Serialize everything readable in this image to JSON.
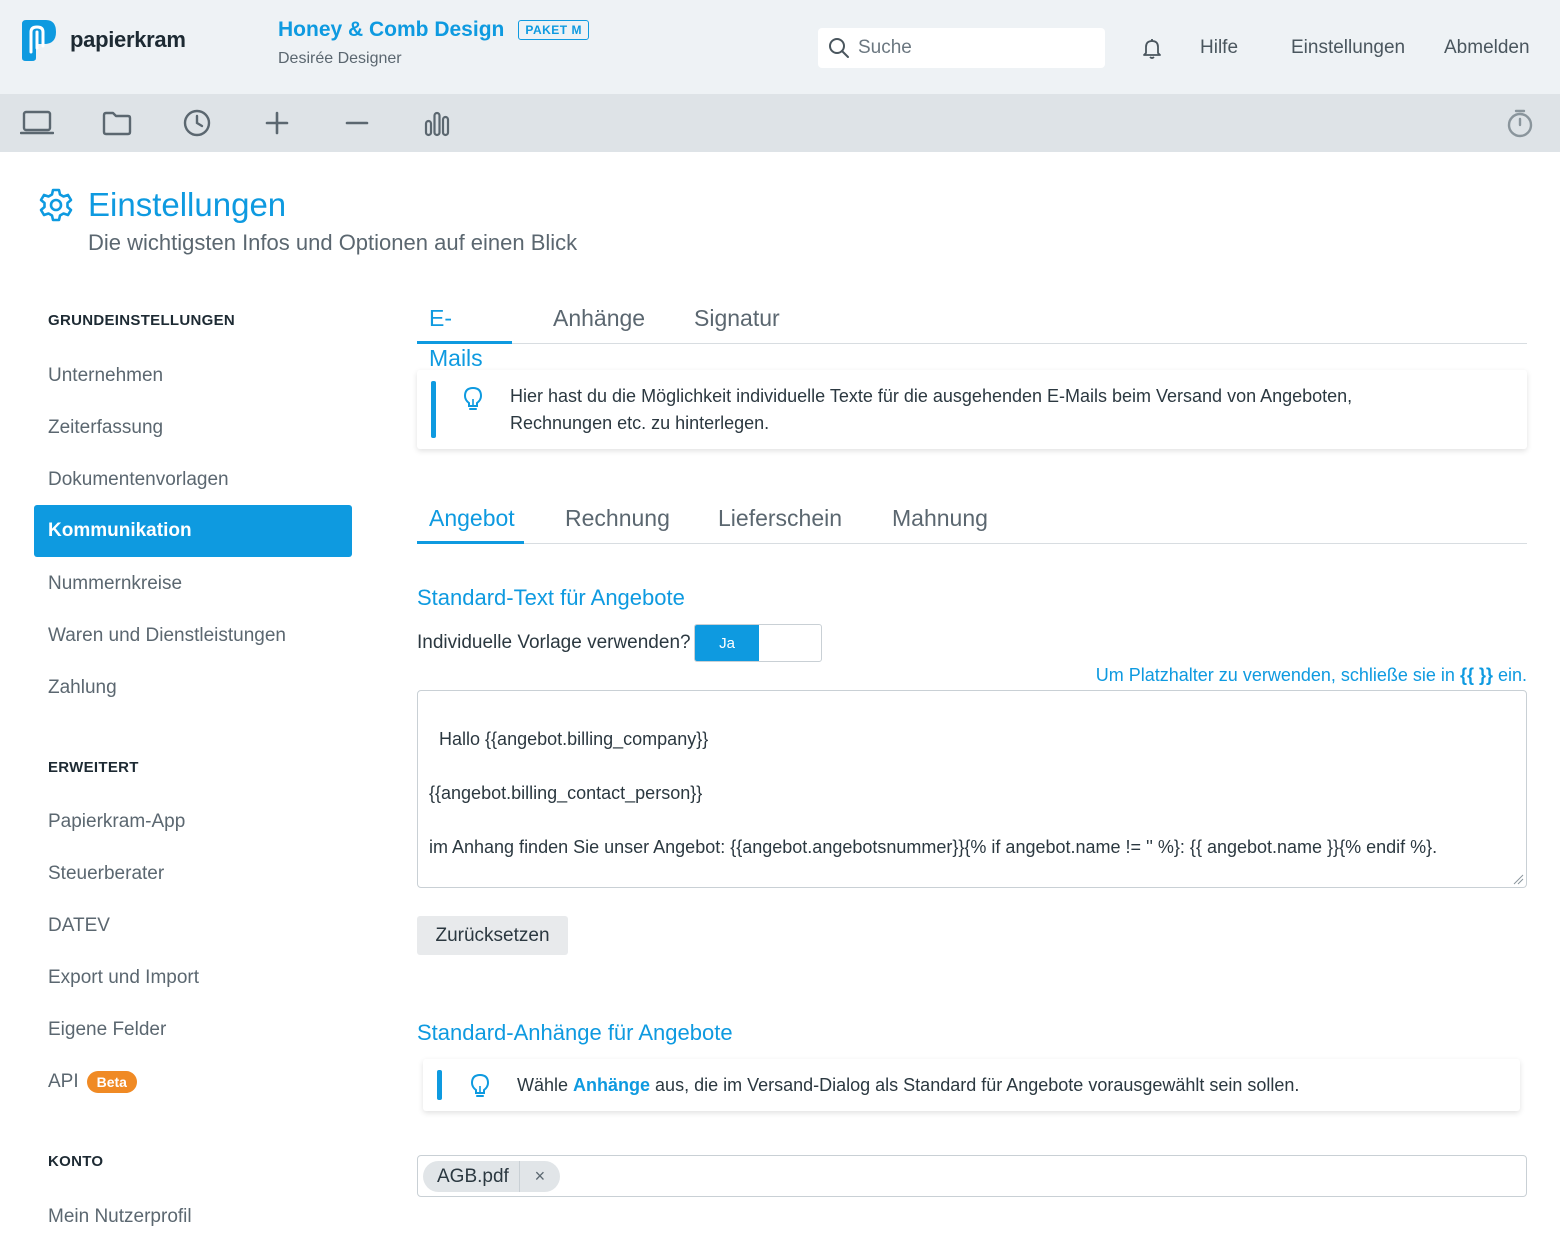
{
  "app": {
    "logo_text": "papierkram"
  },
  "header": {
    "company_name": "Honey & Comb Design",
    "plan_badge": "PAKET M",
    "user_name": "Desirée Designer",
    "search_placeholder": "Suche",
    "nav": [
      "Hilfe",
      "Einstellungen",
      "Abmelden"
    ]
  },
  "toolbar": {
    "icons": [
      "laptop-icon",
      "folder-icon",
      "clock-icon",
      "plus-icon",
      "minus-icon",
      "bar-chart-icon",
      "stopwatch-icon"
    ]
  },
  "page": {
    "title": "Einstellungen",
    "subtitle": "Die wichtigsten Infos und Optionen auf einen Blick"
  },
  "sidebar": {
    "sections": [
      "GRUNDEINSTELLUNGEN",
      "ERWEITERT",
      "KONTO"
    ],
    "basic": [
      "Unternehmen",
      "Zeiterfassung",
      "Dokumentenvorlagen",
      "Kommunikation",
      "Nummernkreise",
      "Waren und Dienstleistungen",
      "Zahlung"
    ],
    "advanced": [
      "Papierkram-App",
      "Steuerberater",
      "DATEV",
      "Export und Import",
      "Eigene Felder",
      "API"
    ],
    "beta_badge": "Beta",
    "account": [
      "Mein Nutzerprofil"
    ],
    "active_item": "Kommunikation"
  },
  "main": {
    "tabs": [
      "E-Mails",
      "Anhänge",
      "Signatur"
    ],
    "active_tab": "E-Mails",
    "info_text": "Hier hast du die Möglichkeit individuelle Texte für die ausgehenden E-Mails beim Versand von Angeboten, Rechnungen etc. zu hinterlegen.",
    "doc_tabs": [
      "Angebot",
      "Rechnung",
      "Lieferschein",
      "Mahnung"
    ],
    "active_doc_tab": "Angebot",
    "text_section_title": "Standard-Text für Angebote",
    "toggle_label": "Individuelle Vorlage verwenden?",
    "toggle_value": "Ja",
    "placeholder_hint_pre": "Um Platzhalter zu verwenden, schließe sie in ",
    "placeholder_hint_code": "{{ }}",
    "placeholder_hint_post": " ein.",
    "template_text": "Hallo {{angebot.billing_company}}\n\n{{angebot.billing_contact_person}}\n\nim Anhang finden Sie unser Angebot: {{angebot.angebotsnummer}}{% if angebot.name != '' %}: {{ angebot.name }}{% endif %}.",
    "reset_button": "Zurücksetzen",
    "attach_section_title": "Standard-Anhänge für Angebote",
    "attach_info_pre": "Wähle ",
    "attach_info_link": "Anhänge",
    "attach_info_post": " aus, die im Versand-Dialog als Standard für Angebote vorausgewählt sein sollen.",
    "attachments": [
      "AGB.pdf"
    ],
    "tag_remove": "×"
  },
  "colors": {
    "accent": "#0e9ae0",
    "beta": "#f08a24",
    "header_bg": "#eef2f5",
    "toolbar_bg": "#dee3e7"
  }
}
